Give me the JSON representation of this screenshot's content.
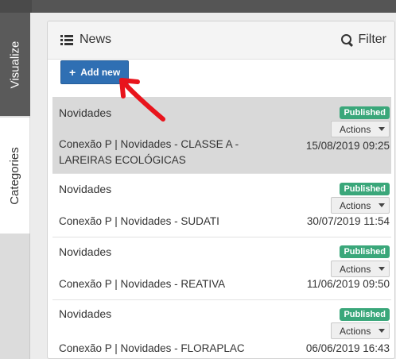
{
  "sidebar": {
    "tabs": [
      {
        "label": "Visualize"
      },
      {
        "label": "Categories"
      }
    ]
  },
  "panel": {
    "title": "News",
    "filter_label": "Filter",
    "add_button_label": "Add new"
  },
  "news": [
    {
      "category": "Novidades",
      "title_line1": "Conexão P | Novidades - CLASSE A -",
      "title_line2": "LAREIRAS ECOLÓGICAS",
      "status": "Published",
      "actions_label": "Actions",
      "date": "15/08/2019 09:25"
    },
    {
      "category": "Novidades",
      "title_line1": "Conexão P | Novidades - SUDATI",
      "status": "Published",
      "actions_label": "Actions",
      "date": "30/07/2019 11:54"
    },
    {
      "category": "Novidades",
      "title_line1": "Conexão P | Novidades - REATIVA",
      "status": "Published",
      "actions_label": "Actions",
      "date": "11/06/2019 09:50"
    },
    {
      "category": "Novidades",
      "title_line1": "Conexão P | Novidades - FLORAPLAC",
      "status": "Published",
      "actions_label": "Actions",
      "date": "06/06/2019 16:43"
    }
  ],
  "colors": {
    "primary_button": "#2f6fb3",
    "published_badge": "#3aa77a",
    "annotation_arrow": "#e8141c",
    "active_tab": "#5a5a5a"
  }
}
